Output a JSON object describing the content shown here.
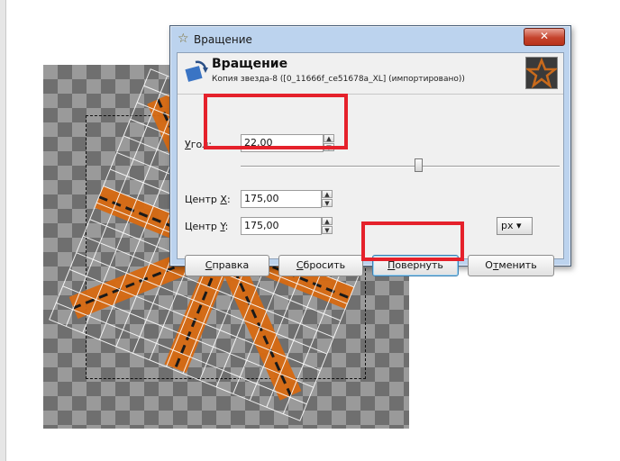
{
  "dialog": {
    "title": "Вращение",
    "header_title": "Вращение",
    "header_subtitle": "Копия звезда-8 ([0_11666f_ce51678a_XL] (импортировано))"
  },
  "angle": {
    "label_u": "У",
    "label_rest": "гол:",
    "value": "22,00"
  },
  "center_x": {
    "label_pre": "Центр ",
    "label_u": "X",
    "label_post": ":",
    "value": "175,00"
  },
  "center_y": {
    "label_pre": "Центр ",
    "label_u": "Y",
    "label_post": ":",
    "value": "175,00"
  },
  "unit": {
    "value": "px"
  },
  "buttons": {
    "help": {
      "u": "С",
      "rest": "правка"
    },
    "reset": {
      "u": "С",
      "rest": "бросить"
    },
    "rotate": {
      "u": "П",
      "rest": "овернуть"
    },
    "cancel": {
      "pre": "О",
      "u": "т",
      "rest": "менить"
    }
  },
  "highlight_color": "#e5212b"
}
